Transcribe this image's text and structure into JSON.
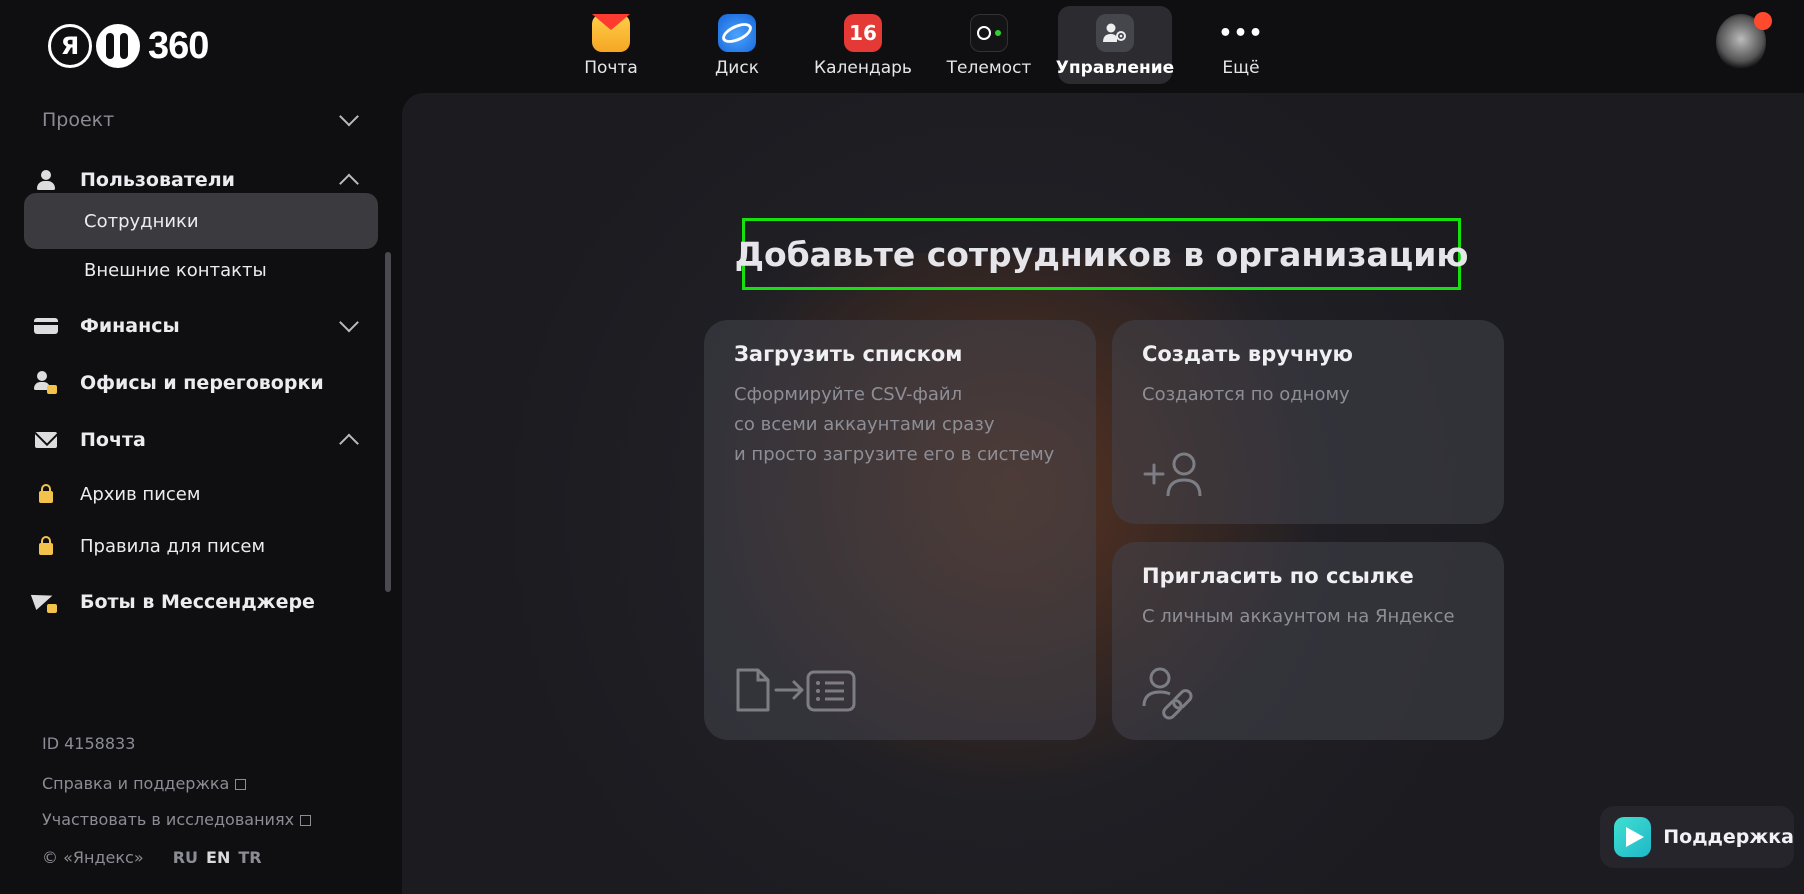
{
  "logo": {
    "ya": "Я",
    "suffix": "360"
  },
  "apps": [
    {
      "label": "Почта",
      "icon": "mail-icon"
    },
    {
      "label": "Диск",
      "icon": "disk-icon"
    },
    {
      "label": "Календарь",
      "icon": "calendar-icon",
      "badge": "16"
    },
    {
      "label": "Телемост",
      "icon": "telemost-icon"
    },
    {
      "label": "Управление",
      "icon": "admin-icon",
      "active": true
    },
    {
      "label": "Ещё",
      "icon": "more-icon",
      "glyph": "•••"
    }
  ],
  "sidebar": {
    "project": "Проект",
    "users": "Пользователи",
    "employees": "Сотрудники",
    "external_contacts": "Внешние контакты",
    "finance": "Финансы",
    "offices": "Офисы и переговорки",
    "mail": "Почта",
    "mail_archive": "Архив писем",
    "mail_rules": "Правила для писем",
    "bots": "Боты в Мессенджере"
  },
  "footer": {
    "id": "ID 4158833",
    "help": "Справка и поддержка",
    "research": "Участвовать в исследованиях",
    "copyright": "© «Яндекс»",
    "langs": [
      "RU",
      "EN",
      "TR"
    ],
    "active_lang": "EN"
  },
  "main": {
    "headline": "Добавьте сотрудников в организацию",
    "upload": {
      "title": "Загрузить списком",
      "desc1": "Сформируйте CSV-файл",
      "desc2": "со всеми аккаунтами сразу",
      "desc3": "и просто загрузите его в систему"
    },
    "manual": {
      "title": "Создать вручную",
      "desc": "Создаются по одному"
    },
    "invite": {
      "title": "Пригласить по ссылке",
      "desc": "С личным аккаунтом на Яндексе"
    }
  },
  "support": {
    "label": "Поддержка"
  },
  "colors": {
    "highlight": "#16e010",
    "accent_lock": "#f3c24a",
    "calendar": "#e53935"
  }
}
